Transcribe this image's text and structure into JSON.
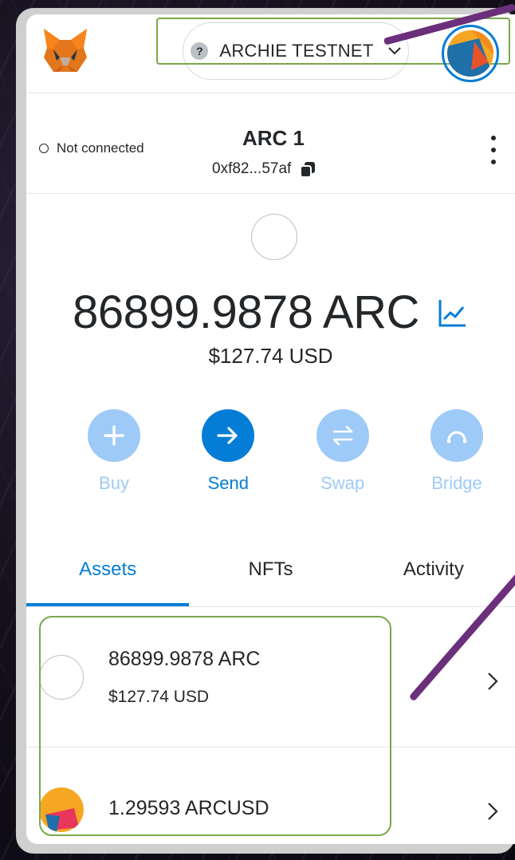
{
  "header": {
    "network_name": "ARCHIE TESTNET",
    "network_icon": "question-icon",
    "network_icon_glyph": "?"
  },
  "account": {
    "connection_status": "Not connected",
    "name": "ARC 1",
    "address": "0xf82...57af"
  },
  "balance": {
    "amount": "86899.9878 ARC",
    "fiat": "$127.74 USD"
  },
  "actions": [
    {
      "label": "Buy",
      "icon": "plus-icon",
      "color": "#9ecaf7",
      "label_color": "#9ecaf7"
    },
    {
      "label": "Send",
      "icon": "arrow-right-icon",
      "color": "#037dd6",
      "label_color": "#037dd6"
    },
    {
      "label": "Swap",
      "icon": "swap-icon",
      "color": "#9ecaf7",
      "label_color": "#9ecaf7"
    },
    {
      "label": "Bridge",
      "icon": "bridge-icon",
      "color": "#9ecaf7",
      "label_color": "#9ecaf7"
    }
  ],
  "tabs": [
    {
      "label": "Assets",
      "active": true
    },
    {
      "label": "NFTs",
      "active": false
    },
    {
      "label": "Activity",
      "active": false
    }
  ],
  "assets": [
    {
      "amount": "86899.9878 ARC",
      "fiat": "$127.74 USD"
    },
    {
      "amount": "1.29593 ARCUSD",
      "fiat": ""
    }
  ],
  "colors": {
    "accent": "#037dd6",
    "accent_muted": "#9ecaf7",
    "annotation_box": "#7aa84a",
    "annotation_arrow": "#6b2f7b"
  }
}
